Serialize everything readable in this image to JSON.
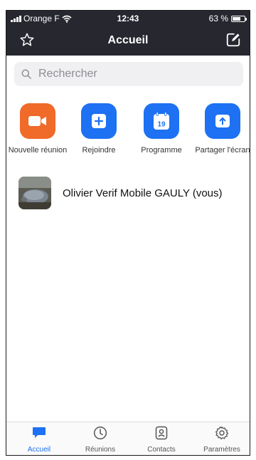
{
  "status_bar": {
    "carrier": "Orange F",
    "time": "12:43",
    "battery": "63 %"
  },
  "header": {
    "title": "Accueil",
    "left_icon": "star-icon",
    "right_icon": "edit-icon"
  },
  "search": {
    "placeholder": "Rechercher"
  },
  "actions": [
    {
      "label": "Nouvelle réunion",
      "icon": "video-camera-icon",
      "color": "#f06a2a"
    },
    {
      "label": "Rejoindre",
      "icon": "plus-icon",
      "color": "#1d71f2"
    },
    {
      "label": "Programme",
      "icon": "calendar-icon",
      "color": "#1d71f2",
      "calendar_day": "19"
    },
    {
      "label": "Partager l'écran",
      "icon": "share-screen-icon",
      "color": "#1d71f2"
    }
  ],
  "contacts": [
    {
      "name": "Olivier Verif Mobile GAULY (vous)"
    }
  ],
  "tabbar": {
    "items": [
      {
        "label": "Accueil",
        "icon": "chat-bubble-icon",
        "active": true
      },
      {
        "label": "Réunions",
        "icon": "clock-icon",
        "active": false
      },
      {
        "label": "Contacts",
        "icon": "contact-card-icon",
        "active": false
      },
      {
        "label": "Paramètres",
        "icon": "gear-icon",
        "active": false
      }
    ]
  },
  "colors": {
    "header_bg": "#26272f",
    "accent": "#1d71f2",
    "new_meeting": "#f06a2a"
  }
}
